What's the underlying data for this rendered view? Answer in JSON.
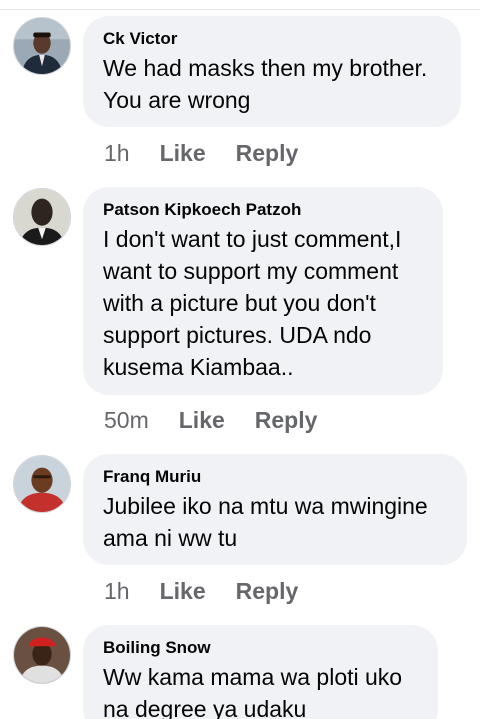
{
  "comments": [
    {
      "author": "Ck Victor",
      "text": "We had masks then my brother. You are wrong",
      "time": "1h",
      "like_label": "Like",
      "reply_label": "Reply",
      "avatar_colors": {
        "bg": "#9aa9b5",
        "face": "#5a3a2a",
        "clothes": "#1f2a3a"
      }
    },
    {
      "author": "Patson Kipkoech Patzoh",
      "text": "I don't want to just comment,I want to support my comment with a picture but you don't support pictures. UDA ndo kusema Kiambaa..",
      "time": "50m",
      "like_label": "Like",
      "reply_label": "Reply",
      "avatar_colors": {
        "bg": "#d8d8d0",
        "face": "#2e2520",
        "clothes": "#1a1a1a"
      }
    },
    {
      "author": "Franq Muriu",
      "text": "Jubilee iko na mtu wa mwingine ama ni ww tu",
      "time": "1h",
      "like_label": "Like",
      "reply_label": "Reply",
      "avatar_colors": {
        "bg": "#c9d3dc",
        "face": "#6b3b22",
        "clothes": "#c4302b"
      }
    },
    {
      "author": "Boiling Snow",
      "text": "Ww kama mama wa ploti uko na degree ya udaku",
      "avatar_colors": {
        "bg": "#6a5040",
        "face": "#3a2418",
        "clothes": "#d02020"
      }
    }
  ]
}
